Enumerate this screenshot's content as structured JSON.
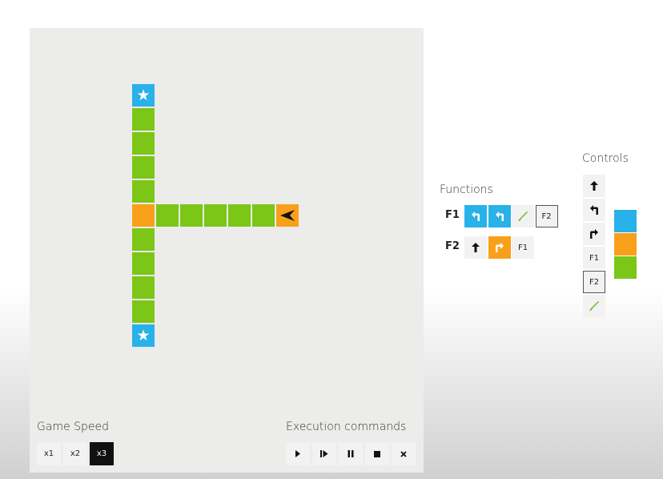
{
  "functions": {
    "title": "Functions",
    "rows": [
      {
        "name": "F1",
        "slots": [
          {
            "kind": "turn-left",
            "color": "blue"
          },
          {
            "kind": "turn-left",
            "color": "blue"
          },
          {
            "kind": "paint",
            "color": "none"
          },
          {
            "kind": "call",
            "label": "F2",
            "color": "none",
            "boxed": true
          }
        ]
      },
      {
        "name": "F2",
        "slots": [
          {
            "kind": "forward",
            "color": "none"
          },
          {
            "kind": "turn-right",
            "color": "orange"
          },
          {
            "kind": "call",
            "label": "F1",
            "color": "none"
          }
        ]
      }
    ]
  },
  "controls": {
    "title": "Controls",
    "items": [
      {
        "kind": "forward"
      },
      {
        "kind": "turn-left"
      },
      {
        "kind": "turn-right"
      },
      {
        "kind": "call",
        "label": "F1"
      },
      {
        "kind": "call",
        "label": "F2",
        "selected": true
      },
      {
        "kind": "paint"
      }
    ],
    "colors": [
      "#29b1ea",
      "#f9a01b",
      "#7cc618"
    ]
  },
  "game_speed": {
    "title": "Game Speed",
    "options": [
      "x1",
      "x2",
      "x3"
    ],
    "selected": "x3"
  },
  "execution": {
    "title": "Execution commands",
    "buttons": [
      "play-icon",
      "step-icon",
      "pause-icon",
      "stop-icon",
      "clear-icon"
    ]
  },
  "board": {
    "grid_unit": "cell",
    "tiles": [
      {
        "col": 0,
        "row": 0,
        "color": "blue",
        "star": true
      },
      {
        "col": 0,
        "row": 1,
        "color": "green"
      },
      {
        "col": 0,
        "row": 2,
        "color": "green"
      },
      {
        "col": 0,
        "row": 3,
        "color": "green"
      },
      {
        "col": 0,
        "row": 4,
        "color": "green"
      },
      {
        "col": 0,
        "row": 5,
        "color": "orange"
      },
      {
        "col": 1,
        "row": 5,
        "color": "green"
      },
      {
        "col": 2,
        "row": 5,
        "color": "green"
      },
      {
        "col": 3,
        "row": 5,
        "color": "green"
      },
      {
        "col": 4,
        "row": 5,
        "color": "green"
      },
      {
        "col": 5,
        "row": 5,
        "color": "green"
      },
      {
        "col": 6,
        "row": 5,
        "color": "orange",
        "robot": "facing-left"
      },
      {
        "col": 0,
        "row": 6,
        "color": "green"
      },
      {
        "col": 0,
        "row": 7,
        "color": "green"
      },
      {
        "col": 0,
        "row": 8,
        "color": "green"
      },
      {
        "col": 0,
        "row": 9,
        "color": "green"
      },
      {
        "col": 0,
        "row": 10,
        "color": "blue",
        "star": true
      }
    ]
  }
}
